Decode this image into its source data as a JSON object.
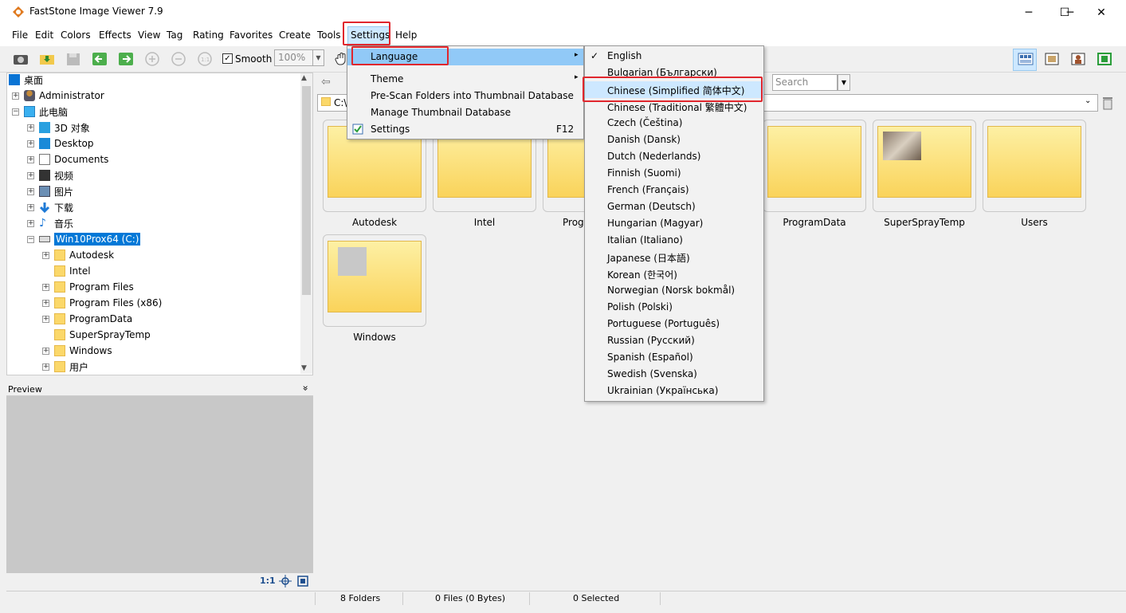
{
  "window": {
    "title": "FastStone Image Viewer 7.9",
    "minimize": "─",
    "maximize": "☐",
    "close": "✕"
  },
  "menubar": [
    "File",
    "Edit",
    "Colors",
    "Effects",
    "View",
    "Tag",
    "Rating",
    "Favorites",
    "Create",
    "Tools",
    "Settings",
    "Help"
  ],
  "toolbar": {
    "smooth_label": "Smooth",
    "smooth_checked": "✓",
    "zoom_value": "100%"
  },
  "settings_menu": {
    "items": [
      {
        "label": "Language",
        "shortcut": "",
        "arrow": "▸"
      },
      {
        "label": "Theme",
        "shortcut": "",
        "arrow": "▸"
      },
      {
        "label": "Pre-Scan Folders into Thumbnail Database",
        "shortcut": "",
        "arrow": ""
      },
      {
        "label": "Manage Thumbnail Database",
        "shortcut": "",
        "arrow": ""
      },
      {
        "label": "Settings",
        "shortcut": "F12",
        "arrow": ""
      }
    ]
  },
  "language_menu": {
    "checked_mark": "✓",
    "items": [
      "English",
      "Bulgarian (Български)",
      "Chinese (Simplified 简体中文)",
      "Chinese (Traditional 繁體中文)",
      "Czech (Čeština)",
      "Danish (Dansk)",
      "Dutch (Nederlands)",
      "Finnish (Suomi)",
      "French (Français)",
      "German (Deutsch)",
      "Hungarian (Magyar)",
      "Italian (Italiano)",
      "Japanese (日本語)",
      "Korean (한국어)",
      "Norwegian (Norsk bokmål)",
      "Polish (Polski)",
      "Portuguese (Português)",
      "Russian (Русский)",
      "Spanish (Español)",
      "Swedish (Svenska)",
      "Ukrainian (Українська)"
    ]
  },
  "tree": {
    "items": [
      {
        "label": "桌面",
        "icon": "desktop-icon"
      },
      {
        "label": "Administrator",
        "icon": "user-icon"
      },
      {
        "label": "此电脑",
        "icon": "computer-icon"
      },
      {
        "label": "3D 对象",
        "icon": "cube-icon"
      },
      {
        "label": "Desktop",
        "icon": "desktop-icon"
      },
      {
        "label": "Documents",
        "icon": "document-icon"
      },
      {
        "label": "视频",
        "icon": "video-icon"
      },
      {
        "label": "图片",
        "icon": "picture-icon"
      },
      {
        "label": "下载",
        "icon": "download-icon"
      },
      {
        "label": "音乐",
        "icon": "music-icon"
      },
      {
        "label": "Win10Prox64 (C:)",
        "icon": "drive-icon"
      },
      {
        "label": "Autodesk",
        "icon": "folder-icon"
      },
      {
        "label": "Intel",
        "icon": "folder-icon"
      },
      {
        "label": "Program Files",
        "icon": "folder-icon"
      },
      {
        "label": "Program Files (x86)",
        "icon": "folder-icon"
      },
      {
        "label": "ProgramData",
        "icon": "folder-icon"
      },
      {
        "label": "SuperSprayTemp",
        "icon": "folder-icon"
      },
      {
        "label": "Windows",
        "icon": "folder-icon"
      },
      {
        "label": "用户",
        "icon": "folder-icon"
      }
    ]
  },
  "preview": {
    "title": "Preview",
    "collapse": "»",
    "ratio_label": "1:1"
  },
  "browser": {
    "path_prefix": "C:\\",
    "search_placeholder": "Search"
  },
  "thumbnails": [
    {
      "label": "Autodesk"
    },
    {
      "label": "Intel"
    },
    {
      "label": "Prog"
    },
    {
      "label": "ProgramData"
    },
    {
      "label": "SuperSprayTemp"
    },
    {
      "label": "Users"
    },
    {
      "label": "Windows"
    }
  ],
  "status": {
    "folders": "8 Folders",
    "files": "0 Files (0 Bytes)",
    "selected": "0 Selected"
  },
  "colors": {
    "highlight": "#0078d7",
    "menu_hover": "#cde8ff",
    "annotation": "#e0262d"
  }
}
